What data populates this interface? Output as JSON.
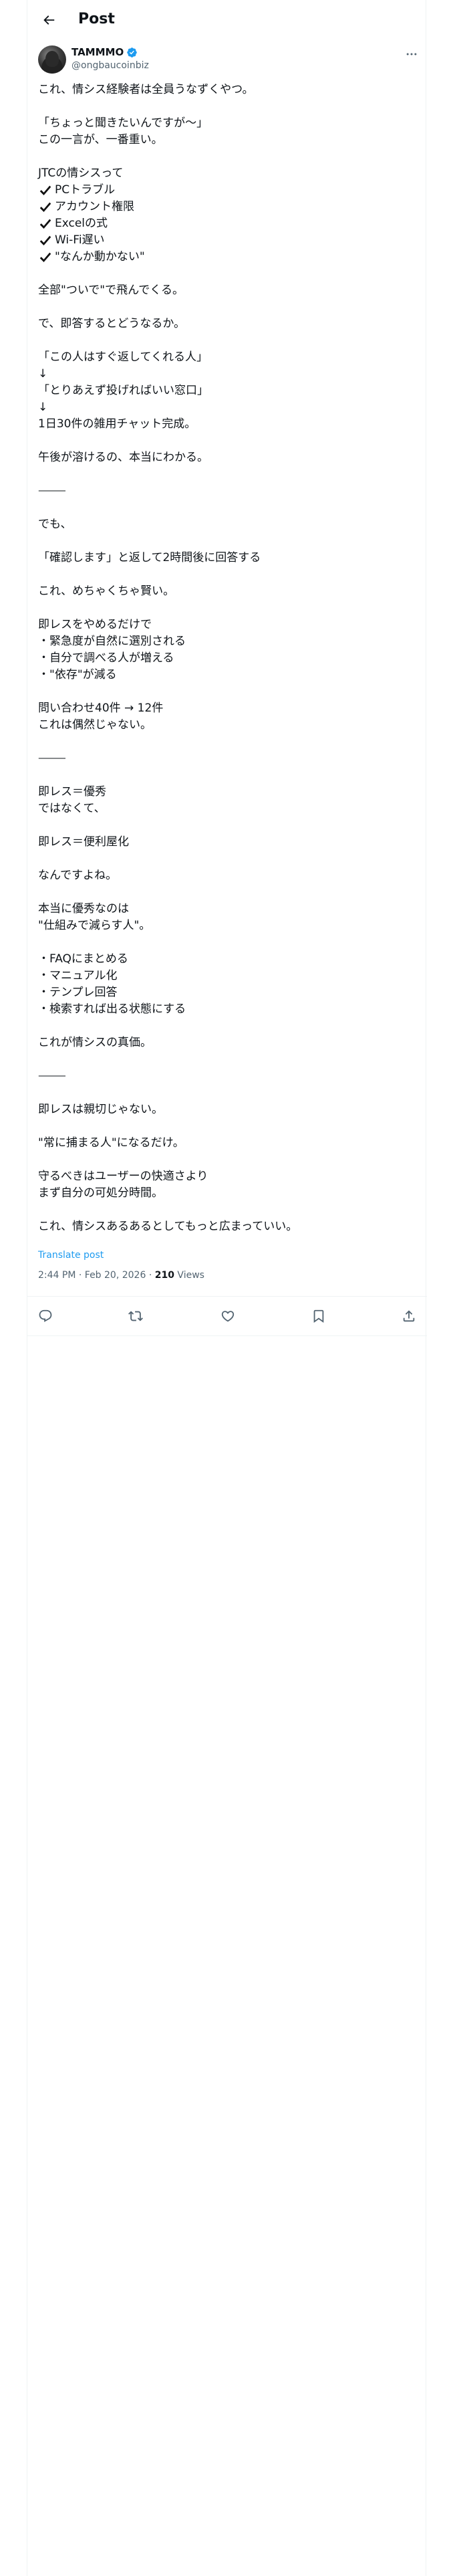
{
  "header": {
    "title": "Post",
    "back_icon": "arrow-left-icon"
  },
  "author": {
    "display_name": "TAMMMO",
    "handle": "@ongbaucoinbiz",
    "verified_color": "#1d9bf0"
  },
  "post": {
    "lines": [
      "これ、情シス経験者は全員うなずくやつ。",
      "",
      "「ちょっと聞きたいんですが〜」",
      "この一言が、一番重い。",
      "",
      "JTCの情シスって",
      "✔PCトラブル",
      "✔アカウント権限",
      "✔Excelの式",
      "✔Wi-Fi遅い",
      "✔\"なんか動かない\"",
      "",
      "全部\"ついで\"で飛んでくる。",
      "",
      "で、即答するとどうなるか。",
      "",
      "「この人はすぐ返してくれる人」",
      "↓",
      "「とりあえず投げればいい窓口」",
      "↓",
      "1日30件の雑用チャット完成。",
      "",
      "午後が溶けるの、本当にわかる。",
      "",
      "⸻",
      "",
      "でも、",
      "",
      "「確認します」と返して2時間後に回答する",
      "",
      "これ、めちゃくちゃ賢い。",
      "",
      "即レスをやめるだけで",
      "・緊急度が自然に選別される",
      "・自分で調べる人が増える",
      "・\"依存\"が減る",
      "",
      "問い合わせ40件 → 12件",
      "これは偶然じゃない。",
      "",
      "⸻",
      "",
      "即レス＝優秀",
      "ではなくて、",
      "",
      "即レス＝便利屋化",
      "",
      "なんですよね。",
      "",
      "本当に優秀なのは",
      "\"仕組みで減らす人\"。",
      "",
      "・FAQにまとめる",
      "・マニュアル化",
      "・テンプレ回答",
      "・検索すれば出る状態にする",
      "",
      "これが情シスの真価。",
      "",
      "⸻",
      "",
      "即レスは親切じゃない。",
      "",
      "\"常に捕まる人\"になるだけ。",
      "",
      "守るべきはユーザーの快適さより",
      "まず自分の可処分時間。",
      "",
      "これ、情シスあるあるとしてもっと広まっていい。"
    ],
    "translate_label": "Translate post",
    "time": "2:44 PM",
    "separator": "·",
    "date": "Feb 20, 2026",
    "views_count": "210",
    "views_label": "Views"
  },
  "actions": [
    {
      "name": "reply-button",
      "icon": "reply-icon"
    },
    {
      "name": "repost-button",
      "icon": "repost-icon"
    },
    {
      "name": "like-button",
      "icon": "heart-icon"
    },
    {
      "name": "bookmark-button",
      "icon": "bookmark-icon"
    },
    {
      "name": "share-button",
      "icon": "share-icon"
    }
  ]
}
